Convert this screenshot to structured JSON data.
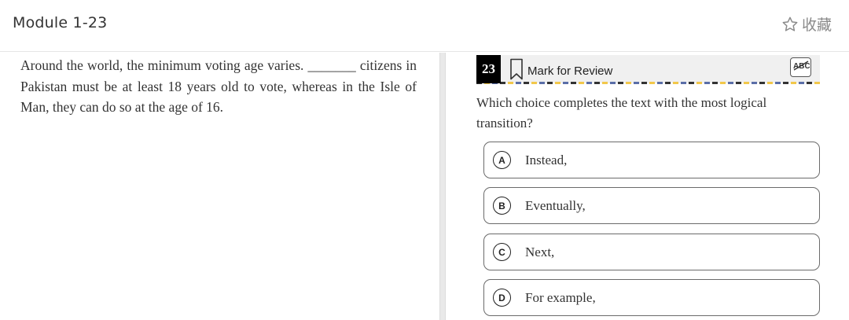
{
  "header": {
    "title": "Module 1-23",
    "favorite_label": "收藏",
    "favorite_icon": "star-outline-icon"
  },
  "passage": {
    "text": "Around the world, the minimum voting age varies. _______ citizens in Pakistan must be at least 18 years old to vote, whereas in the Isle of Man, they can do so at the age of 16."
  },
  "question": {
    "number": "23",
    "mark_for_review_label": "Mark for Review",
    "bookmark_icon": "bookmark-icon",
    "abc_icon": "abc-strikethrough-icon",
    "prompt": "Which choice completes the text with the most logical transition?",
    "choices": [
      {
        "letter": "A",
        "text": "Instead,"
      },
      {
        "letter": "B",
        "text": "Eventually,"
      },
      {
        "letter": "C",
        "text": "Next,"
      },
      {
        "letter": "D",
        "text": "For example,"
      }
    ]
  },
  "colors": {
    "question_number_bg": "#000000",
    "question_bar_bg": "#f0f0f0",
    "choice_border": "#6b6b6b",
    "favorite_gray": "#8a8a8a"
  }
}
